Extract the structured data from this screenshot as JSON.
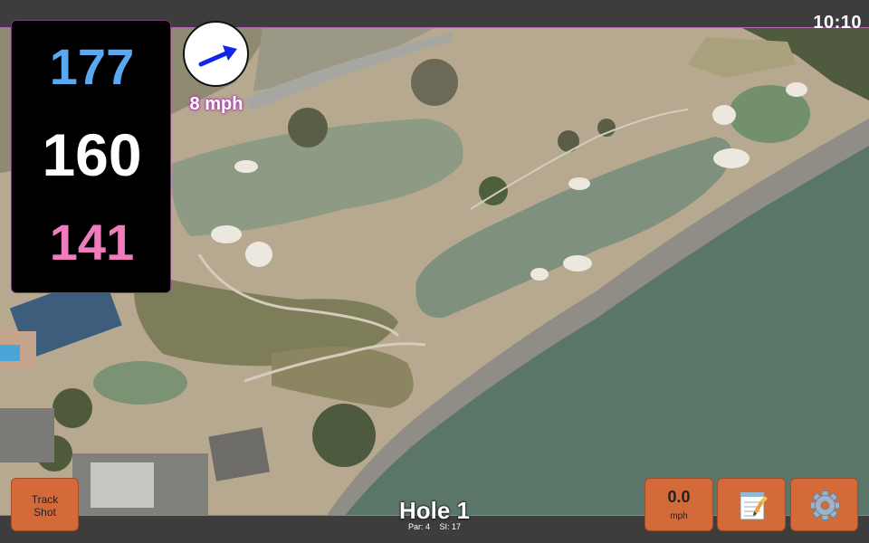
{
  "status_bar": {
    "clock": "10:10"
  },
  "yardages": {
    "back": "177",
    "center": "160",
    "front": "141"
  },
  "wind": {
    "speed_label": "8 mph",
    "direction": "east-northeast",
    "icon": "wind-arrow-icon"
  },
  "hole": {
    "title": "Hole 1",
    "par": "Par: 4",
    "stroke_index": "SI: 17"
  },
  "buttons": {
    "track_shot": {
      "line1": "Track",
      "line2": "Shot"
    },
    "speed": {
      "value": "0.0",
      "unit": "mph"
    },
    "notes": {
      "icon": "notepad-icon"
    },
    "settings": {
      "icon": "gear-icon"
    }
  },
  "colors": {
    "back_yardage": "#5aa8ef",
    "center_yardage": "#ffffff",
    "front_yardage": "#f07cbd",
    "button_orange": "#d46a3a",
    "wind_arrow": "#1026e8",
    "accent_purple": "#b43bb5"
  }
}
